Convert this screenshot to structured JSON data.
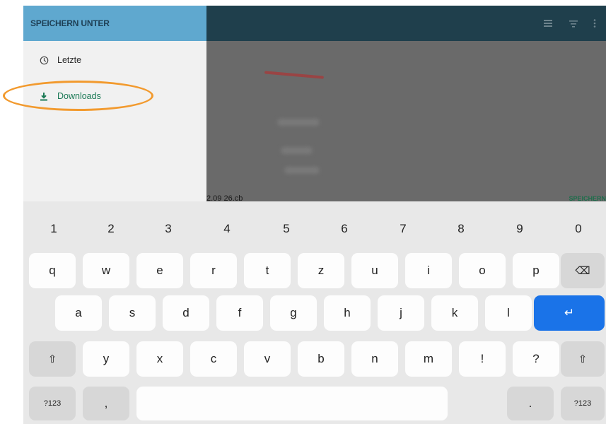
{
  "drawer": {
    "title": "SPEICHERN UNTER",
    "items": [
      {
        "label": "Letzte",
        "icon": "clock-icon"
      },
      {
        "label": "Downloads",
        "icon": "download-icon"
      }
    ]
  },
  "content": {
    "filename": "2.09 26.cb",
    "save_label": "SPEICHERN",
    "toolbar_icons": [
      "list-view-icon",
      "sort-icon",
      "more-icon"
    ]
  },
  "keyboard": {
    "number_row": [
      "1",
      "2",
      "3",
      "4",
      "5",
      "6",
      "7",
      "8",
      "9",
      "0"
    ],
    "row1": [
      "q",
      "w",
      "e",
      "r",
      "t",
      "z",
      "u",
      "i",
      "o",
      "p"
    ],
    "row2": [
      "a",
      "s",
      "d",
      "f",
      "g",
      "h",
      "j",
      "k",
      "l"
    ],
    "row3": [
      "y",
      "x",
      "c",
      "v",
      "b",
      "n",
      "m",
      "!",
      "?"
    ],
    "symbols_label": "?123",
    "comma": ",",
    "period": ".",
    "enter_symbol": "↵",
    "backspace_symbol": "⌫",
    "shift_symbol": "⇧"
  },
  "colors": {
    "drawer_header": "#5fa8cf",
    "toolbar": "#1f3f4c",
    "accent_green": "#1c7a56",
    "highlight": "#f29a2e",
    "enter_key": "#1a73e8"
  }
}
